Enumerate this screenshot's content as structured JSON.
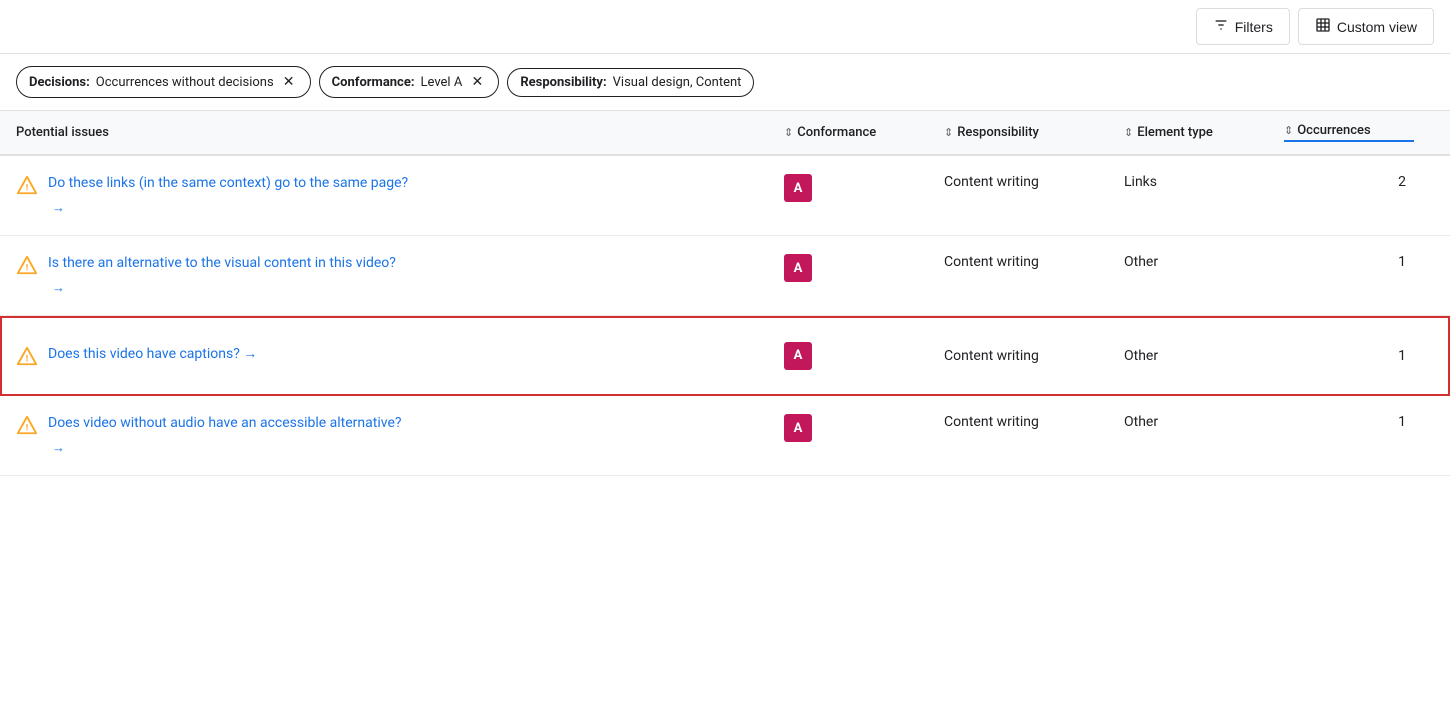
{
  "toolbar": {
    "filters_label": "Filters",
    "custom_view_label": "Custom view"
  },
  "filter_chips": [
    {
      "id": "decisions-chip",
      "label": "Decisions:",
      "value": "Occurrences without decisions",
      "has_close": true
    },
    {
      "id": "conformance-chip",
      "label": "Conformance:",
      "value": "Level A",
      "has_close": true
    },
    {
      "id": "responsibility-chip",
      "label": "Responsibility:",
      "value": "Visual design, Content",
      "has_close": false
    }
  ],
  "table": {
    "columns": [
      {
        "id": "potential-issues",
        "label": "Potential issues",
        "sortable": false
      },
      {
        "id": "conformance",
        "label": "Conformance",
        "sortable": true
      },
      {
        "id": "responsibility",
        "label": "Responsibility",
        "sortable": true
      },
      {
        "id": "element-type",
        "label": "Element type",
        "sortable": true
      },
      {
        "id": "occurrences",
        "label": "Occurrences",
        "sortable": true,
        "active": true
      }
    ],
    "rows": [
      {
        "id": "row-1",
        "title": "Do these links (in the same context) go to the same page?",
        "conformance_badge": "A",
        "responsibility": "Content writing",
        "element_type": "Links",
        "occurrences": "2",
        "highlighted": false,
        "has_arrow_below": true,
        "inline_arrow": false
      },
      {
        "id": "row-2",
        "title": "Is there an alternative to the visual content in this video?",
        "conformance_badge": "A",
        "responsibility": "Content writing",
        "element_type": "Other",
        "occurrences": "1",
        "highlighted": false,
        "has_arrow_below": true,
        "inline_arrow": false
      },
      {
        "id": "row-3",
        "title": "Does this video have captions?",
        "conformance_badge": "A",
        "responsibility": "Content writing",
        "element_type": "Other",
        "occurrences": "1",
        "highlighted": true,
        "has_arrow_below": false,
        "inline_arrow": true,
        "inline_arrow_text": "→"
      },
      {
        "id": "row-4",
        "title": "Does video without audio have an accessible alternative?",
        "conformance_badge": "A",
        "responsibility": "Content writing",
        "element_type": "Other",
        "occurrences": "1",
        "highlighted": false,
        "has_arrow_below": true,
        "inline_arrow": false
      }
    ]
  },
  "icons": {
    "filter": "⊟",
    "table": "⊞",
    "sort": "⇕",
    "arrow_right": "→",
    "close": "✕"
  }
}
